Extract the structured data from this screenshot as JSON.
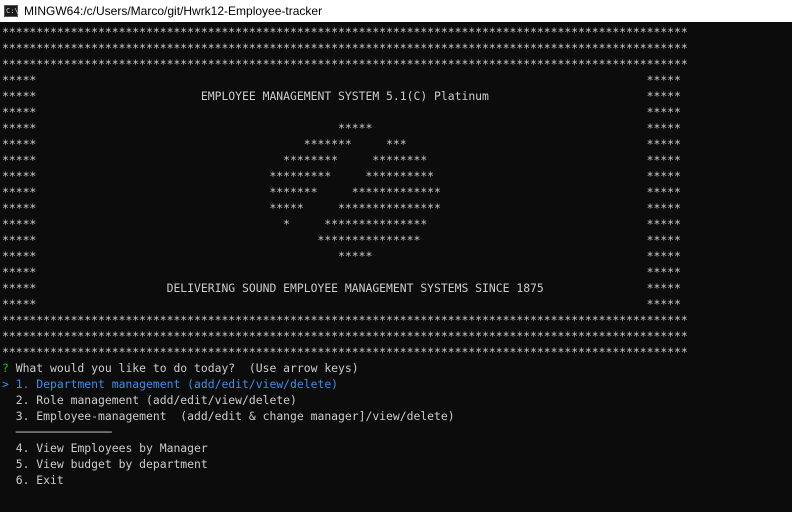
{
  "window": {
    "icon_glyph": "C:\\",
    "title": "MINGW64:/c/Users/Marco/git/Hwrk12-Employee-tracker"
  },
  "banner": [
    "****************************************************************************************************",
    "****************************************************************************************************",
    "****************************************************************************************************",
    "*****                                                                                         *****",
    "*****                        EMPLOYEE MANAGEMENT SYSTEM 5.1(C) Platinum                       *****",
    "*****                                                                                         *****",
    "*****                                            *****                                        *****",
    "*****                                       *******     ***                                   *****",
    "*****                                    ********     ********                                *****",
    "*****                                  *********     **********                               *****",
    "*****                                  *******     *************                              *****",
    "*****                                  *****     ***************                              *****",
    "*****                                    *     ***************                                *****",
    "*****                                         ***************                                 *****",
    "*****                                            *****                                        *****",
    "*****                                                                                         *****",
    "*****                   DELIVERING SOUND EMPLOYEE MANAGEMENT SYSTEMS SINCE 1875               *****",
    "*****                                                                                         *****",
    "****************************************************************************************************",
    "****************************************************************************************************",
    "****************************************************************************************************"
  ],
  "prompt": {
    "marker": "?",
    "question": " What would you like to do today?",
    "hint": "  (Use arrow keys)"
  },
  "menu": {
    "pointer": ">",
    "options": [
      "1. Department management (add/edit/view/delete)",
      "2. Role management (add/edit/view/delete)",
      "3. Employee-management  (add/edit & change manager]/view/delete)"
    ],
    "separator": "──────────────",
    "more_options": [
      "4. View Employees by Manager",
      "5. View budget by department",
      "6. Exit"
    ]
  },
  "colors": {
    "terminal_bg": "#0c0c0c",
    "terminal_fg": "#cccccc",
    "prompt_marker": "#16c60c",
    "selected": "#3b8eea"
  }
}
